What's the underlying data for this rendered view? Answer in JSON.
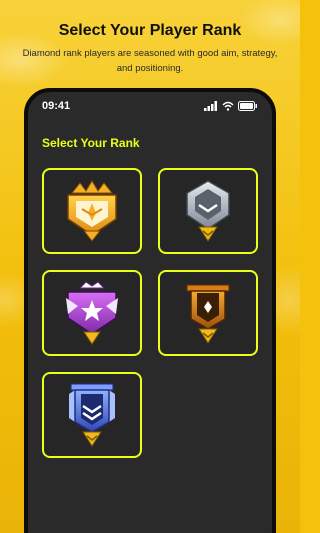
{
  "header": {
    "title": "Select Your Player Rank",
    "subtitle": "Diamond rank players are seasoned with good aim, strategy, and positioning."
  },
  "phone": {
    "time": "09:41",
    "section_title": "Select Your Rank"
  },
  "ranks": [
    {
      "icon": "grandmaster-badge-icon",
      "accent": "#f5b026"
    },
    {
      "icon": "platinum-badge-icon",
      "accent": "#aeb6c1"
    },
    {
      "icon": "heroic-badge-icon",
      "accent": "#b043d6"
    },
    {
      "icon": "gold-badge-icon",
      "accent": "#e58a1c"
    },
    {
      "icon": "diamond-badge-icon",
      "accent": "#4b6bd9"
    }
  ],
  "colors": {
    "background": "#f4c20d",
    "accent": "#e8ff1a",
    "phone_screen": "#2a2a2a"
  }
}
